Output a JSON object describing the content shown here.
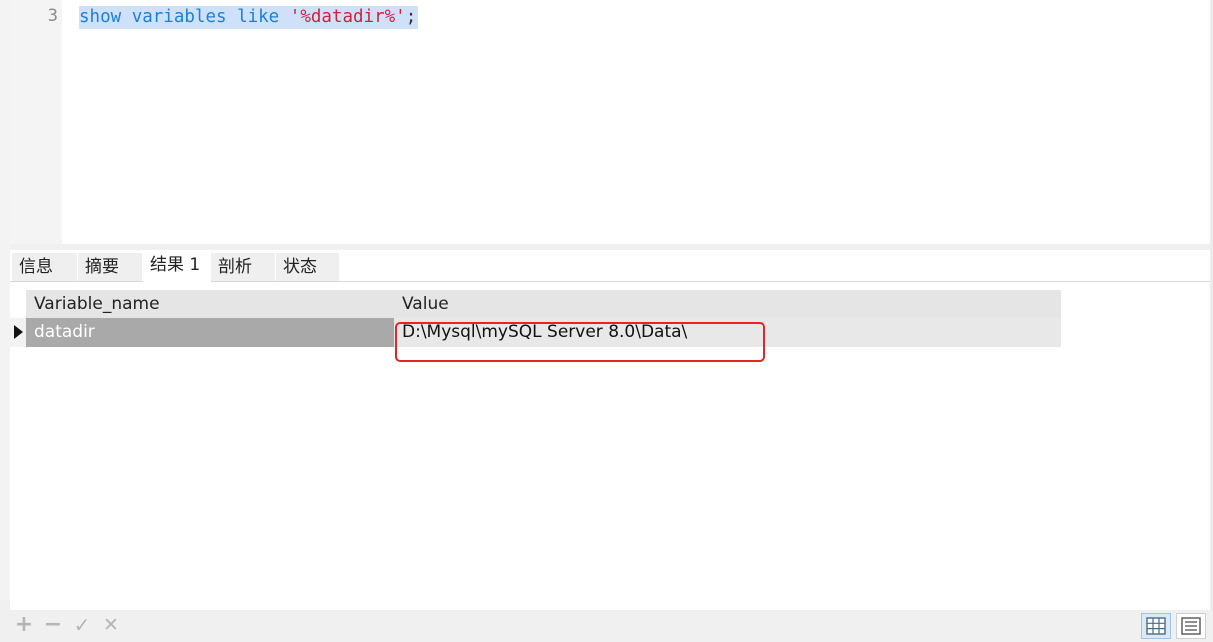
{
  "editor": {
    "line_number": "3",
    "code": {
      "kw_show": "show",
      "kw_variables": "variables",
      "kw_like": "like",
      "string": "'%datadir%'",
      "terminator": ";"
    }
  },
  "tabs": [
    {
      "label": "信息",
      "active": false
    },
    {
      "label": "摘要",
      "active": false
    },
    {
      "label": "结果 1",
      "active": true
    },
    {
      "label": "剖析",
      "active": false
    },
    {
      "label": "状态",
      "active": false
    }
  ],
  "results": {
    "columns": [
      "Variable_name",
      "Value"
    ],
    "rows": [
      {
        "name": "datadir",
        "value": "D:\\Mysql\\mySQL Server 8.0\\Data\\"
      }
    ]
  },
  "bottom_toolbar": {
    "add": "+",
    "remove": "−",
    "apply": "✓",
    "discard": "✕",
    "grid_view_icon": "grid-view-icon",
    "form_view_icon": "form-view-icon"
  },
  "colors": {
    "keyword": "#1c7fd8",
    "string": "#d4203e",
    "selection": "#cfe1f8",
    "highlight_box": "#e8242a"
  }
}
